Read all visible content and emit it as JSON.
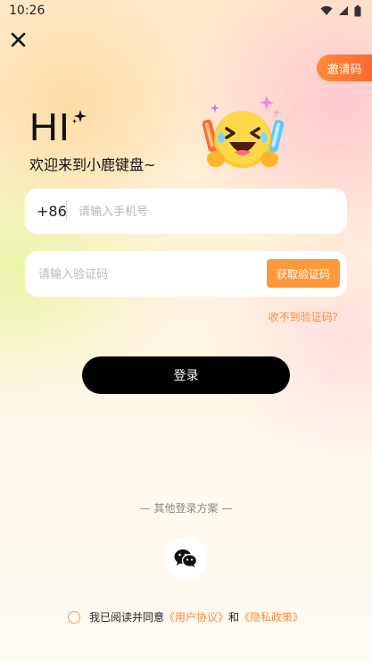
{
  "status_bar": {
    "time": "10:26",
    "icons": [
      "wifi-icon",
      "signal-icon",
      "battery-icon"
    ]
  },
  "header": {
    "close_icon": "close-icon",
    "invite_label": "邀请码"
  },
  "hero": {
    "title": "HI",
    "subtitle": "欢迎来到小鹿键盘~",
    "mascot": "laughing-emoji-mascot"
  },
  "phone_field": {
    "country_code": "+86",
    "placeholder": "请输入手机号",
    "value": ""
  },
  "code_field": {
    "placeholder": "请输入验证码",
    "value": "",
    "get_code_label": "获取验证码"
  },
  "no_code_link": "收不到验证码?",
  "login_label": "登录",
  "other_login": {
    "label": "— 其他登录方案 —",
    "wechat_icon": "wechat-icon"
  },
  "agreement": {
    "prefix": "我已阅读并同意",
    "user_agreement": "《用户协议》",
    "and": "和",
    "privacy_policy": "《隐私政策》",
    "checked": false
  },
  "colors": {
    "accent": "#ff9a3c",
    "link": "#ff8a3a",
    "invite_gradient_start": "#ff8a3d",
    "invite_gradient_end": "#ff6a2c",
    "login_button": "#000000"
  }
}
